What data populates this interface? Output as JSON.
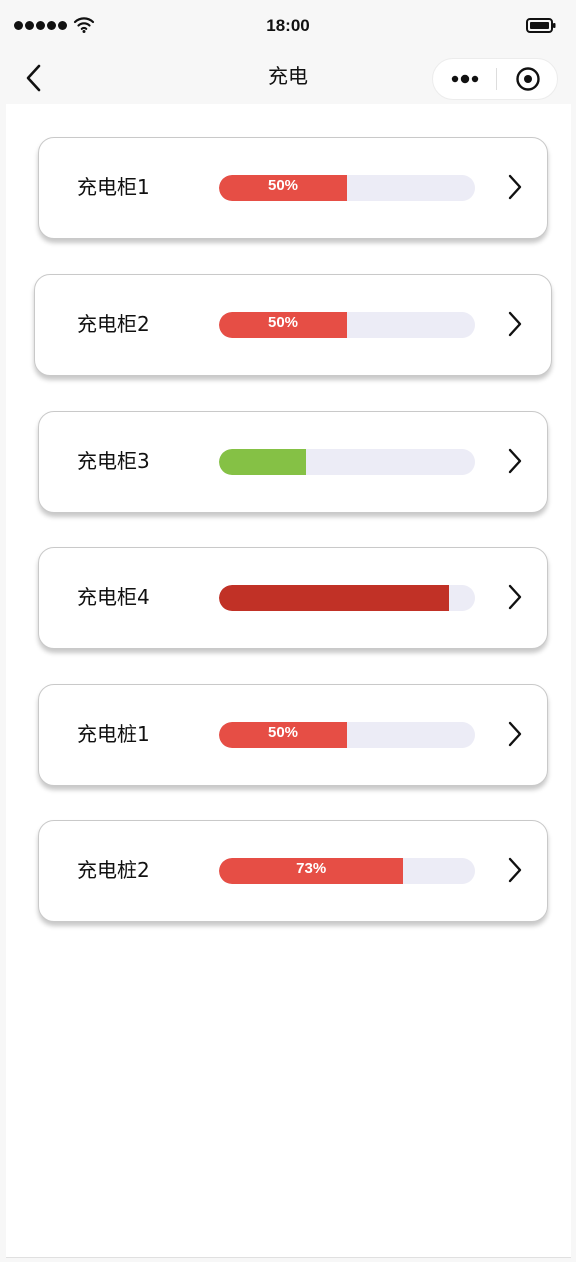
{
  "status_bar": {
    "time": "18:00",
    "signal_icon": "signal-dots-icon",
    "wifi_icon": "wifi-icon",
    "battery_icon": "battery-icon"
  },
  "nav": {
    "title": "充电",
    "back_icon": "chevron-left-icon",
    "more_icon": "more-dots-icon",
    "close_icon": "target-circle-icon"
  },
  "devices": [
    {
      "name": "充电柜1",
      "progress_fraction": 0.5,
      "label": "50%",
      "color": "#e64e45"
    },
    {
      "name": "充电柜2",
      "progress_fraction": 0.5,
      "label": "50%",
      "color": "#e64e45"
    },
    {
      "name": "充电柜3",
      "progress_fraction": 0.34,
      "label": "",
      "color": "#85c145"
    },
    {
      "name": "充电柜4",
      "progress_fraction": 0.9,
      "label": "",
      "color": "#c13126"
    },
    {
      "name": "充电桩1",
      "progress_fraction": 0.5,
      "label": "50%",
      "color": "#e64e45"
    },
    {
      "name": "充电桩2",
      "progress_fraction": 0.72,
      "label": "73%",
      "color": "#e64e45"
    }
  ],
  "colors": {
    "track": "#ececf6",
    "label_text": "#ffffff"
  }
}
